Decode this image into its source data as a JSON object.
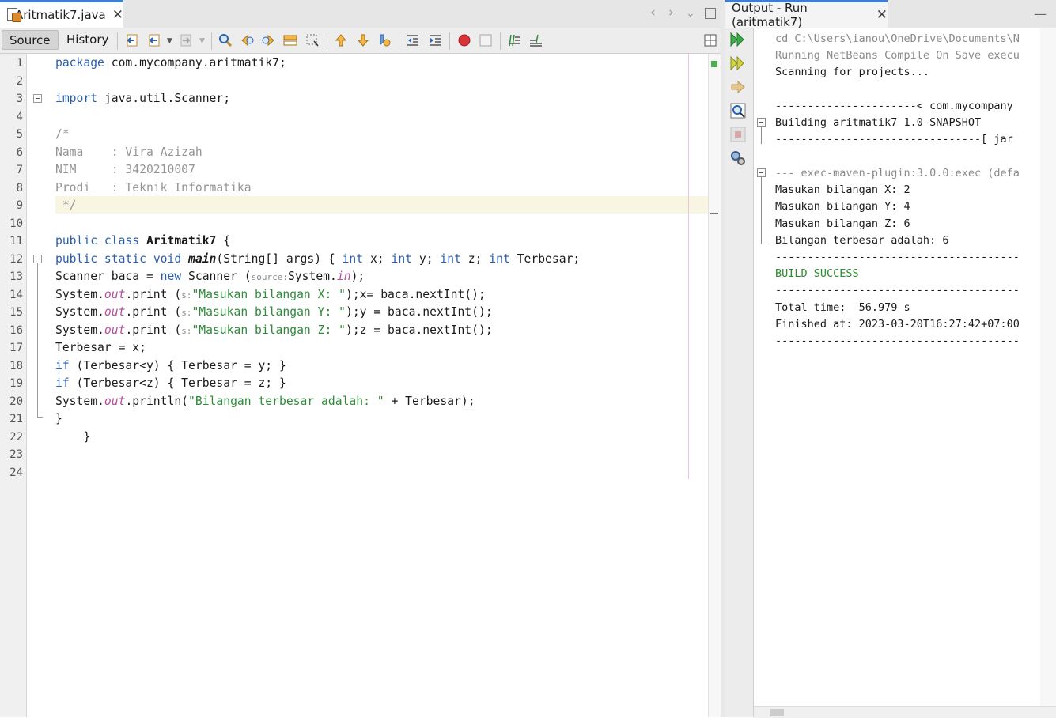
{
  "editor": {
    "file_tab": {
      "name": "Aritmatik7.java",
      "close_icon": "close-icon"
    },
    "toolbar": {
      "source_label": "Source",
      "history_label": "History"
    },
    "line_numbers": [
      "1",
      "2",
      "3",
      "4",
      "5",
      "6",
      "7",
      "8",
      "9",
      "10",
      "11",
      "12",
      "13",
      "14",
      "15",
      "16",
      "17",
      "18",
      "19",
      "20",
      "21",
      "22",
      "23",
      "24"
    ],
    "code": {
      "l1": {
        "kw": "package",
        "rest": " com.mycompany.aritmatik7;"
      },
      "l3": {
        "kw": "import",
        "rest": " java.util.Scanner;"
      },
      "l5": "/*",
      "l6": "Nama    : Vira Azizah",
      "l7": "NIM     : 3420210007",
      "l8": "Prodi   : Teknik Informatika",
      "l9": " */",
      "l11": {
        "kw1": "public",
        "kw2": "class",
        "name": "Aritmatik7",
        "rest": " {"
      },
      "l12": {
        "kw1": "public",
        "kw2": "static",
        "kw3": "void",
        "method": "main",
        "args": "(String[] args) { ",
        "t1": "int",
        "v1": " x; ",
        "t2": "int",
        "v2": " y; ",
        "t3": "int",
        "v3": " z; ",
        "t4": "int",
        "v4": " Terbesar;"
      },
      "l13": {
        "pre": "Scanner baca = ",
        "kw": "new",
        "mid": " Scanner (",
        "hint": "source:",
        "obj": "System.",
        "fld": "in",
        "post": ");"
      },
      "l14": {
        "pre": "System.",
        "fld": "out",
        "mid": ".print (",
        "hint": "s:",
        "str": "\"Masukan bilangan X: \"",
        "post": ");x= baca.nextInt();"
      },
      "l15": {
        "pre": "System.",
        "fld": "out",
        "mid": ".print (",
        "hint": "s:",
        "str": "\"Masukan bilangan Y: \"",
        "post": ");y = baca.nextInt();"
      },
      "l16": {
        "pre": "System.",
        "fld": "out",
        "mid": ".print (",
        "hint": "s:",
        "str": "\"Masukan bilangan Z: \"",
        "post": ");z = baca.nextInt();"
      },
      "l17": "Terbesar = x;",
      "l18": {
        "kw": "if",
        "rest": " (Terbesar<y) { Terbesar = y; }"
      },
      "l19": {
        "kw": "if",
        "rest": " (Terbesar<z) { Terbesar = z; }"
      },
      "l20": {
        "pre": "System.",
        "fld": "out",
        "mid": ".println(",
        "str": "\"Bilangan terbesar adalah: \"",
        "post": " + Terbesar);"
      },
      "l21": "}",
      "l22": "    }"
    }
  },
  "output": {
    "tab_title": "Output - Run (aritmatik7)",
    "lines": {
      "o1": "cd C:\\Users\\ianou\\OneDrive\\Documents\\N",
      "o2": "Running NetBeans Compile On Save execu",
      "o3": "Scanning for projects...",
      "o5": "----------------------< com.mycompany",
      "o6": "Building aritmatik7 1.0-SNAPSHOT",
      "o7": "--------------------------------[ jar",
      "o9": "--- exec-maven-plugin:3.0.0:exec (defa",
      "o10": "Masukan bilangan X: 2",
      "o11": "Masukan bilangan Y: 4",
      "o12": "Masukan bilangan Z: 6",
      "o13": "Bilangan terbesar adalah: 6",
      "o14": "--------------------------------------",
      "o15": "BUILD SUCCESS",
      "o16": "--------------------------------------",
      "o17": "Total time:  56.979 s",
      "o18": "Finished at: 2023-03-20T16:27:42+07:00",
      "o19": "--------------------------------------"
    }
  },
  "colors": {
    "keyword": "#2a5db0",
    "comment": "#959595",
    "string": "#2f8a3a",
    "field": "#b24fa0",
    "accent": "#3b7fd4",
    "success": "#2e8b2e"
  }
}
